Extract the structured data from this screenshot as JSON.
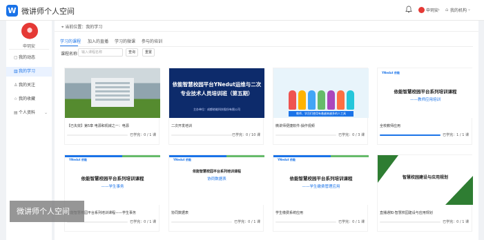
{
  "header": {
    "app_title": "微讲师个人空间",
    "logo_text": "W",
    "user_name": "申玥安",
    "org_label": "我的机构"
  },
  "sidebar": {
    "user_name": "申玥安",
    "items": [
      {
        "label": "我的动态",
        "icon": "activity-icon"
      },
      {
        "label": "我的学习",
        "icon": "study-icon"
      },
      {
        "label": "我的关注",
        "icon": "follow-icon"
      },
      {
        "label": "我的收藏",
        "icon": "favorite-icon"
      },
      {
        "label": "个人资料",
        "icon": "profile-icon"
      }
    ]
  },
  "breadcrumb": "当前位置：我的学习",
  "tabs": [
    "学习的课程",
    "加入的直播",
    "学习的微课",
    "参与的培训"
  ],
  "filter": {
    "label": "课程名称",
    "placeholder": "输入课程名称",
    "search_label": "查询",
    "reset_label": "重置"
  },
  "cards": [
    {
      "title": "【已失效】第5章 电源和机械之一：电源",
      "progress_text": "已学完：0 / 1 课",
      "progress": 0
    },
    {
      "title": "二次开发培训",
      "progress_text": "已学完：0 / 10 课",
      "progress": 0,
      "thumb_line1": "依能智慧校园平台YNedut运维与二次",
      "thumb_line2": "专业技术人员培训班（第五期）",
      "thumb_line3": "主办单位：成都依能科技股份有限公司"
    },
    {
      "title": "微讲师便捷软件-操作视频",
      "progress_text": "已学完：0 / 3 课",
      "progress": 0,
      "thumb_caption": "教师、学员们使用有着越来越多的人工具"
    },
    {
      "title": "全校教师应用",
      "progress_text": "已学完：1 / 1 课",
      "progress": 1,
      "thumb_badge": "YNedut 依能",
      "thumb_line1": "依能智慧校园平台系列培训课程",
      "thumb_line2": "——教师应用培训"
    },
    {
      "title": "依能智慧校园平台系列培训课程——学生事务",
      "progress_text": "已学完：0 / 1 课",
      "progress": 0,
      "thumb_badge": "YNedut 依能",
      "thumb_line1": "依能智慧校园平台系列培训课程",
      "thumb_line2": "——学生事务"
    },
    {
      "title": "协同数据表",
      "progress_text": "已学完：0 / 1 课",
      "progress": 0,
      "thumb_badge": "YNedut 依能",
      "thumb_line1": "依能智慧校园平台系列培训课程",
      "thumb_line2": "协同数据表"
    },
    {
      "title": "学生缴费系统应用",
      "progress_text": "已学完：0 / 1 课",
      "progress": 0,
      "thumb_badge": "YNedut 依能",
      "thumb_line1": "依能智慧校园平台系列培训课程",
      "thumb_line2": "——学生缴费管理应用"
    },
    {
      "title": "直播通知-智慧校园建设与应用规划",
      "progress_text": "已学完：0 / 1 课",
      "progress": 0,
      "thumb_line1": "智慧校园建设与应用规划"
    }
  ],
  "watermark": "微讲师个人空间",
  "colors": {
    "accent": "#1a73e8",
    "navy": "#0d2b6b",
    "green": "#2e7d32",
    "avatar_red": "#e53935"
  }
}
